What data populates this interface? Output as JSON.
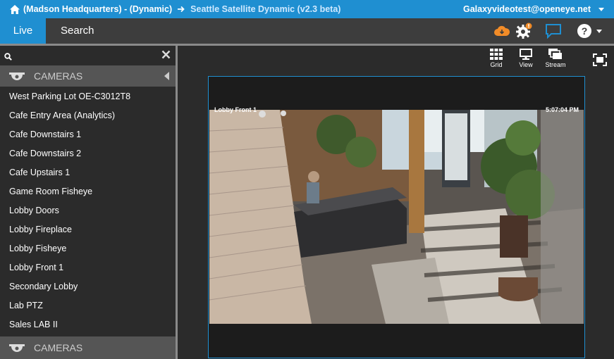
{
  "header": {
    "breadcrumb_root": "(Madson Headquarters) - (Dynamic)",
    "breadcrumb_current": "Seattle Satellite Dynamic (v2.3 beta)",
    "user": "Galaxyvideotest@openeye.net"
  },
  "nav": {
    "tabs": [
      {
        "label": "Live",
        "active": true
      },
      {
        "label": "Search",
        "active": false
      }
    ],
    "icons": [
      "cloud-alert-icon",
      "gear-alert-icon",
      "chat-icon",
      "help-icon"
    ]
  },
  "sidebar": {
    "search": {
      "value": "",
      "placeholder": ""
    },
    "section_label": "CAMERAS",
    "cameras": [
      "West Parking Lot OE-C3012T8",
      "Cafe Entry Area (Analytics)",
      "Cafe Downstairs 1",
      "Cafe Downstairs 2",
      "Cafe Upstairs 1",
      "Game Room Fisheye",
      "Lobby Doors",
      "Lobby Fireplace",
      "Lobby Fisheye",
      "Lobby Front 1",
      "Secondary Lobby",
      "Lab PTZ",
      "Sales LAB II"
    ],
    "section_label_2": "CAMERAS"
  },
  "toolbar": {
    "grid_label": "Grid",
    "view_label": "View",
    "stream_label": "Stream"
  },
  "video": {
    "camera_name": "Lobby Front 1",
    "timestamp": "5:07:04 PM"
  },
  "colors": {
    "accent": "#1f8fd1",
    "alert": "#f28c28"
  }
}
